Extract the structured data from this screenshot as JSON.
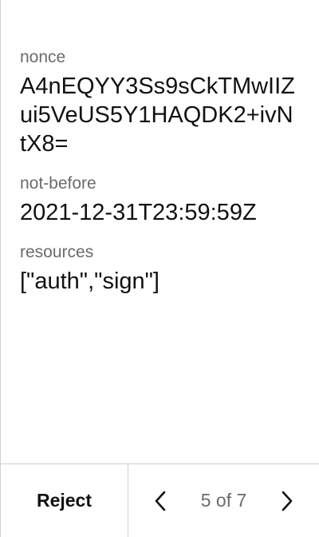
{
  "fields": [
    {
      "label": "nonce",
      "value": "A4nEQYY3Ss9sCkTMwIIZui5VeUS5Y1HAQDK2+ivNtX8="
    },
    {
      "label": "not-before",
      "value": "2021-12-31T23:59:59Z"
    },
    {
      "label": "resources",
      "value": "[\"auth\",\"sign\"]"
    }
  ],
  "footer": {
    "reject_label": "Reject",
    "page_indicator": "5 of 7",
    "prev_icon": "chevron-left-icon",
    "next_icon": "chevron-right-icon"
  },
  "colors": {
    "text": "#111111",
    "label": "#6b6b6b",
    "border": "#cfcfcf",
    "background": "#ffffff"
  }
}
